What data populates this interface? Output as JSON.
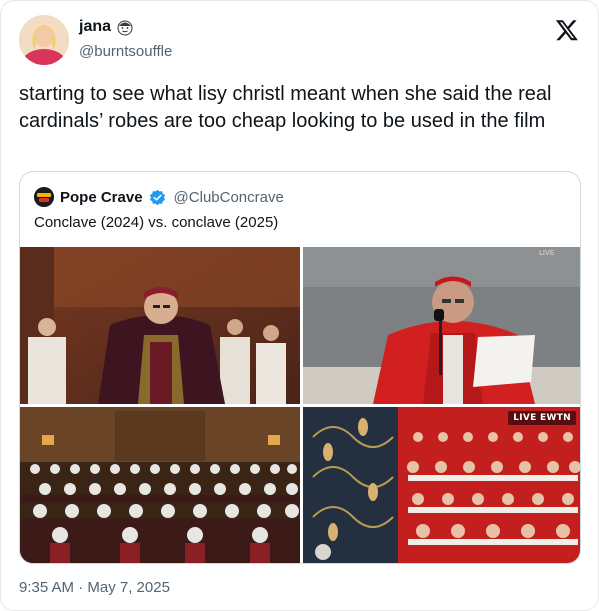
{
  "author": {
    "display_name": "jana",
    "handle": "@burntsouffle",
    "avatar_icon": "avatar-photo",
    "badge_icon": "face-emoji-icon"
  },
  "tweet": {
    "text": "starting to see what lisy christl meant when she said the real cardinals’ robes are too cheap looking to be used in the film",
    "timestamp": "9:35 AM · May 7, 2025"
  },
  "quoted_tweet": {
    "display_name": "Pope Crave",
    "handle": "@ClubConcrave",
    "text": "Conclave (2024) vs. conclave (2025)",
    "verified_color": "#1d9bf0",
    "images": [
      {
        "name": "conclave-film-cardinal"
      },
      {
        "name": "real-cardinal-at-microphone"
      },
      {
        "name": "conclave-film-cardinals-assembly"
      },
      {
        "name": "real-cardinals-group-photo",
        "badge": "LIVE EWTN"
      }
    ]
  },
  "colors": {
    "text_primary": "#0f1419",
    "text_secondary": "#536471",
    "border": "#cfd9de"
  }
}
